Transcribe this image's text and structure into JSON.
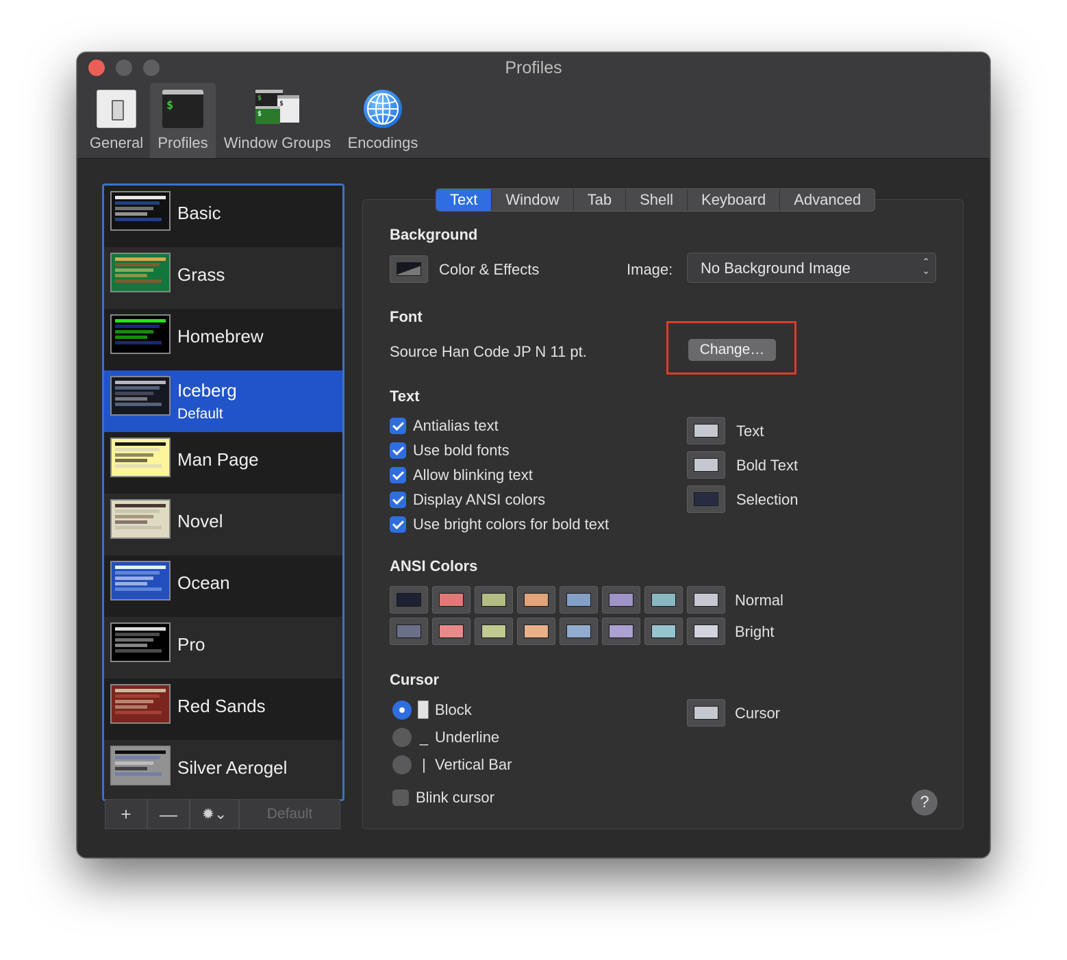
{
  "window": {
    "title": "Profiles"
  },
  "toolbar": [
    {
      "label": "General",
      "icon": "general-icon"
    },
    {
      "label": "Profiles",
      "icon": "terminal-icon"
    },
    {
      "label": "Window Groups",
      "icon": "window-groups-icon"
    },
    {
      "label": "Encodings",
      "icon": "globe-icon"
    }
  ],
  "terminal_prompt_glyph": "$",
  "profiles": [
    {
      "name": "Basic",
      "colors": [
        "#111111",
        "#ffffff",
        "#2d6bd6",
        "#bfbfbf"
      ]
    },
    {
      "name": "Grass",
      "colors": [
        "#13773d",
        "#e6b34a",
        "#d8442a",
        "#f3d36b"
      ]
    },
    {
      "name": "Homebrew",
      "colors": [
        "#000000",
        "#28fe14",
        "#2a4fd0",
        "#28fe14"
      ]
    },
    {
      "name": "Iceberg",
      "subtitle": "Default",
      "colors": [
        "#161821",
        "#c6c8d1",
        "#84a0c6",
        "#6b7089"
      ]
    },
    {
      "name": "Man Page",
      "colors": [
        "#fef49c",
        "#000000",
        "#cccccc",
        "#333333"
      ]
    },
    {
      "name": "Novel",
      "colors": [
        "#dfdbc3",
        "#3b2322",
        "#b8b39f",
        "#7a5c44"
      ]
    },
    {
      "name": "Ocean",
      "colors": [
        "#224fbc",
        "#ffffff",
        "#8fb4ef",
        "#ffffff"
      ]
    },
    {
      "name": "Pro",
      "colors": [
        "#000000",
        "#f2f2f2",
        "#888888",
        "#cccccc"
      ]
    },
    {
      "name": "Red Sands",
      "colors": [
        "#7a251e",
        "#d7c9a7",
        "#c05a45",
        "#efd5b0"
      ]
    },
    {
      "name": "Silver Aerogel",
      "colors": [
        "#929292",
        "#000000",
        "#5a6fb8",
        "#dcdcdc"
      ]
    }
  ],
  "sidebar_buttons": {
    "add": "+",
    "remove": "—",
    "gear": "✹⌄",
    "default": "Default"
  },
  "tabs": [
    "Text",
    "Window",
    "Tab",
    "Shell",
    "Keyboard",
    "Advanced"
  ],
  "background": {
    "heading": "Background",
    "color_effects": "Color & Effects",
    "image_label": "Image:",
    "image_value": "No Background Image"
  },
  "font": {
    "heading": "Font",
    "value": "Source Han Code JP N 11 pt.",
    "change_button": "Change…"
  },
  "text": {
    "heading": "Text",
    "options": [
      {
        "label": "Antialias text",
        "checked": true
      },
      {
        "label": "Use bold fonts",
        "checked": true
      },
      {
        "label": "Allow blinking text",
        "checked": true
      },
      {
        "label": "Display ANSI colors",
        "checked": true
      },
      {
        "label": "Use bright colors for bold text",
        "checked": true
      }
    ],
    "colors": [
      {
        "label": "Text",
        "color": "#c6c8d1"
      },
      {
        "label": "Bold Text",
        "color": "#c6c8d1"
      },
      {
        "label": "Selection",
        "color": "#272c42"
      }
    ]
  },
  "ansi": {
    "heading": "ANSI Colors",
    "normal_label": "Normal",
    "bright_label": "Bright",
    "normal": [
      "#1e2132",
      "#e27878",
      "#b4be82",
      "#e2a478",
      "#84a0c6",
      "#a093c7",
      "#89b8c2",
      "#c6c8d1"
    ],
    "bright": [
      "#6b7089",
      "#e98989",
      "#c0ca8e",
      "#e9b189",
      "#91acd1",
      "#ada0d3",
      "#95c4ce",
      "#d2d4de"
    ]
  },
  "cursor": {
    "heading": "Cursor",
    "options": [
      {
        "glyph": "▉",
        "label": "Block",
        "selected": true
      },
      {
        "glyph": "_",
        "label": "Underline",
        "selected": false
      },
      {
        "glyph": "|",
        "label": "Vertical Bar",
        "selected": false
      }
    ],
    "blink_label": "Blink cursor",
    "blink_checked": false,
    "color_label": "Cursor",
    "color": "#c6c8d1"
  },
  "help": "?"
}
